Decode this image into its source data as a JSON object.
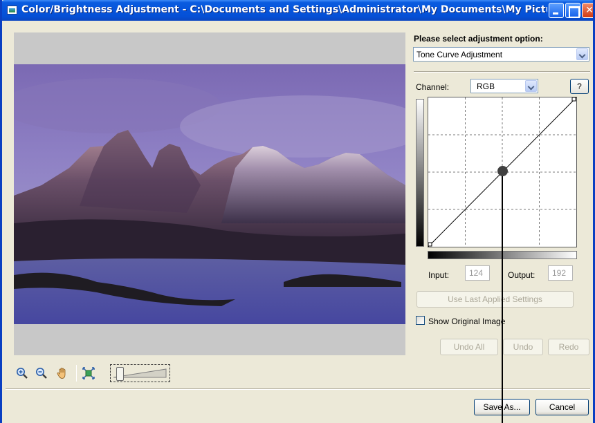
{
  "window": {
    "title": "Color/Brightness Adjustment - C:\\Documents and Settings\\Administrator\\My Documents\\My Pictures\\xxxx_xx...",
    "accent_color": "#0a5ce0",
    "close_color": "#d33a12"
  },
  "preview": {
    "image_desc_icon": "mountain-landscape-photo"
  },
  "toolbar": {
    "zoom_in_icon": "zoom-in-icon",
    "zoom_out_icon": "zoom-out-icon",
    "pan_icon": "hand-icon",
    "fit_icon": "fit-to-window-icon",
    "zoom_level": 0.05
  },
  "panel": {
    "option_label": "Please select adjustment option:",
    "option_value": "Tone Curve Adjustment",
    "channel_label": "Channel:",
    "channel_value": "RGB",
    "help_label": "?",
    "input_label": "Input:",
    "input_value": "124",
    "output_label": "Output:",
    "output_value": "192",
    "use_last_label": "Use Last Applied Settings",
    "show_original_label": "Show Original Image",
    "show_original_checked": false,
    "undo_all_label": "Undo All",
    "undo_label": "Undo",
    "redo_label": "Redo"
  },
  "footer": {
    "save_as_label": "Save As...",
    "cancel_label": "Cancel"
  },
  "curve": {
    "points": [
      [
        0,
        0
      ],
      [
        124,
        124
      ],
      [
        255,
        255
      ]
    ]
  }
}
